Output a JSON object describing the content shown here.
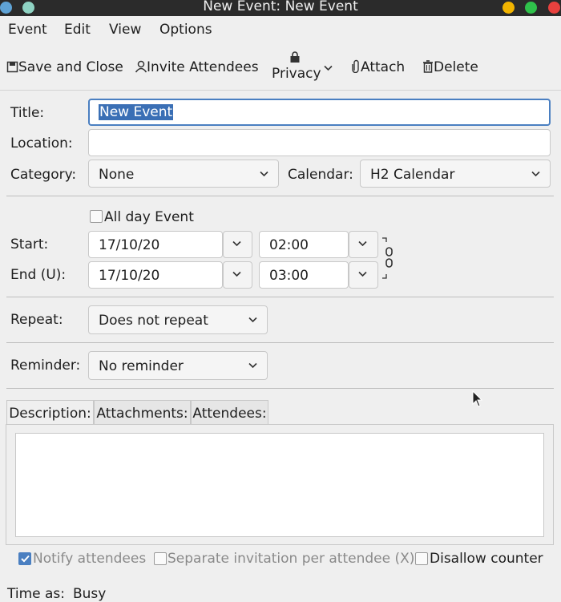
{
  "window": {
    "title": "New Event: New Event"
  },
  "menu": [
    "Event",
    "Edit",
    "View",
    "Options"
  ],
  "toolbar": {
    "save_close": "Save and Close",
    "invite": "Invite Attendees",
    "privacy": "Privacy",
    "attach": "Attach",
    "delete": "Delete"
  },
  "form": {
    "title_label": "Title:",
    "title_value": "New Event",
    "location_label": "Location:",
    "location_value": "",
    "category_label": "Category:",
    "category_value": "None",
    "calendar_label": "Calendar:",
    "calendar_value": "H2 Calendar",
    "allday_label": "All day Event",
    "start_label": "Start:",
    "start_date": "17/10/20",
    "start_time": "02:00",
    "end_label": "End (U):",
    "end_date": "17/10/20",
    "end_time": "03:00",
    "repeat_label": "Repeat:",
    "repeat_value": "Does not repeat",
    "reminder_label": "Reminder:",
    "reminder_value": "No reminder"
  },
  "tabs": [
    "Description:",
    "Attachments:",
    "Attendees:"
  ],
  "options": {
    "notify": "Notify attendees",
    "separate": "Separate invitation per attendee (X)",
    "disallow": "Disallow counter"
  },
  "footer": {
    "time_as_label": "Time as:",
    "time_as_value": "Busy"
  },
  "colors": {
    "accent": "#4a7fc1",
    "selection": "#3a6fb5",
    "titlebar": "#2b2b2b"
  }
}
